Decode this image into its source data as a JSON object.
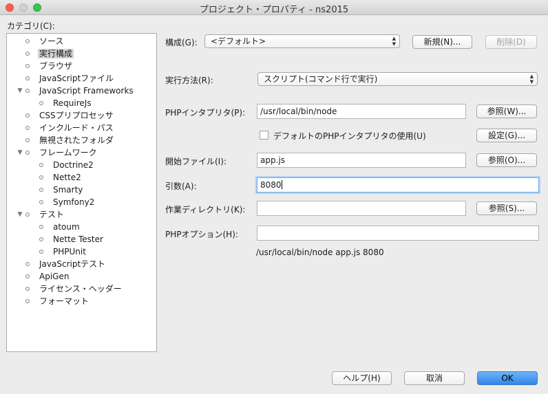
{
  "window": {
    "title": "プロジェクト・プロパティ - ns2015"
  },
  "categories": {
    "label": "カテゴリ(C):",
    "items": [
      {
        "label": "ソース",
        "level": 0,
        "expandable": false,
        "selected": false
      },
      {
        "label": "実行構成",
        "level": 0,
        "expandable": false,
        "selected": true
      },
      {
        "label": "ブラウザ",
        "level": 0,
        "expandable": false,
        "selected": false
      },
      {
        "label": "JavaScriptファイル",
        "level": 0,
        "expandable": false,
        "selected": false
      },
      {
        "label": "JavaScript Frameworks",
        "level": 0,
        "expandable": true,
        "selected": false
      },
      {
        "label": "RequireJs",
        "level": 1,
        "expandable": false,
        "selected": false
      },
      {
        "label": "CSSプリプロセッサ",
        "level": 0,
        "expandable": false,
        "selected": false
      },
      {
        "label": "インクルード・パス",
        "level": 0,
        "expandable": false,
        "selected": false
      },
      {
        "label": "無視されたフォルダ",
        "level": 0,
        "expandable": false,
        "selected": false
      },
      {
        "label": "フレームワーク",
        "level": 0,
        "expandable": true,
        "selected": false
      },
      {
        "label": "Doctrine2",
        "level": 1,
        "expandable": false,
        "selected": false
      },
      {
        "label": "Nette2",
        "level": 1,
        "expandable": false,
        "selected": false
      },
      {
        "label": "Smarty",
        "level": 1,
        "expandable": false,
        "selected": false
      },
      {
        "label": "Symfony2",
        "level": 1,
        "expandable": false,
        "selected": false
      },
      {
        "label": "テスト",
        "level": 0,
        "expandable": true,
        "selected": false
      },
      {
        "label": "atoum",
        "level": 1,
        "expandable": false,
        "selected": false
      },
      {
        "label": "Nette Tester",
        "level": 1,
        "expandable": false,
        "selected": false
      },
      {
        "label": "PHPUnit",
        "level": 1,
        "expandable": false,
        "selected": false
      },
      {
        "label": "JavaScriptテスト",
        "level": 0,
        "expandable": false,
        "selected": false
      },
      {
        "label": "ApiGen",
        "level": 0,
        "expandable": false,
        "selected": false
      },
      {
        "label": "ライセンス・ヘッダー",
        "level": 0,
        "expandable": false,
        "selected": false
      },
      {
        "label": "フォーマット",
        "level": 0,
        "expandable": false,
        "selected": false
      }
    ]
  },
  "config": {
    "label": "構成(G):",
    "value": "<デフォルト>",
    "new_button": "新規(N)...",
    "delete_button": "削除(D)"
  },
  "run_method": {
    "label": "実行方法(R):",
    "value": "スクリプト(コマンド行で実行)"
  },
  "php_interpreter": {
    "label": "PHPインタプリタ(P):",
    "value": "/usr/local/bin/node",
    "browse_button": "参照(W)...",
    "use_default_label": "デフォルトのPHPインタプリタの使用(U)",
    "use_default_checked": false,
    "settings_button": "設定(G)..."
  },
  "start_file": {
    "label": "開始ファイル(I):",
    "value": "app.js",
    "browse_button": "参照(O)..."
  },
  "arguments": {
    "label": "引数(A):",
    "value": "8080"
  },
  "working_dir": {
    "label": "作業ディレクトリ(K):",
    "value": "",
    "browse_button": "参照(S)..."
  },
  "php_options": {
    "label": "PHPオプション(H):",
    "value": ""
  },
  "command_preview": "/usr/local/bin/node app.js 8080",
  "footer": {
    "help_button": "ヘルプ(H)",
    "cancel_button": "取消",
    "ok_button": "OK"
  },
  "colors": {
    "ok_button": "#2f86ea",
    "focus_ring": "#6ea7e9",
    "selection": "#d4d4d4"
  }
}
